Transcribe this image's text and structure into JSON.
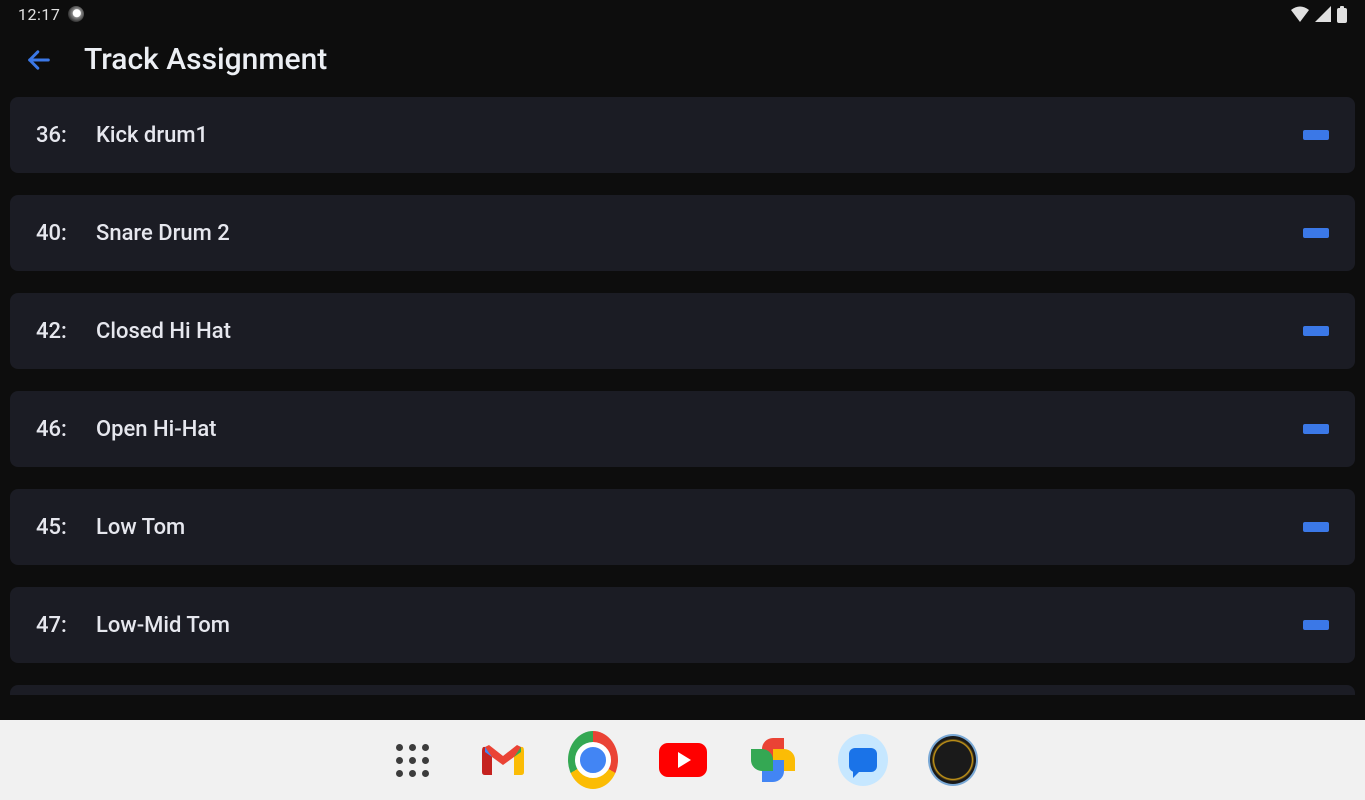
{
  "status": {
    "time": "12:17"
  },
  "header": {
    "title": "Track Assignment"
  },
  "tracks": [
    {
      "num": "36:",
      "name": "Kick drum1"
    },
    {
      "num": "40:",
      "name": "Snare Drum 2"
    },
    {
      "num": "42:",
      "name": "Closed Hi Hat"
    },
    {
      "num": "46:",
      "name": "Open Hi-Hat"
    },
    {
      "num": "45:",
      "name": "Low Tom"
    },
    {
      "num": "47:",
      "name": "Low-Mid Tom"
    }
  ],
  "colors": {
    "accent": "#3b78e7",
    "row_bg": "#1b1c24"
  }
}
